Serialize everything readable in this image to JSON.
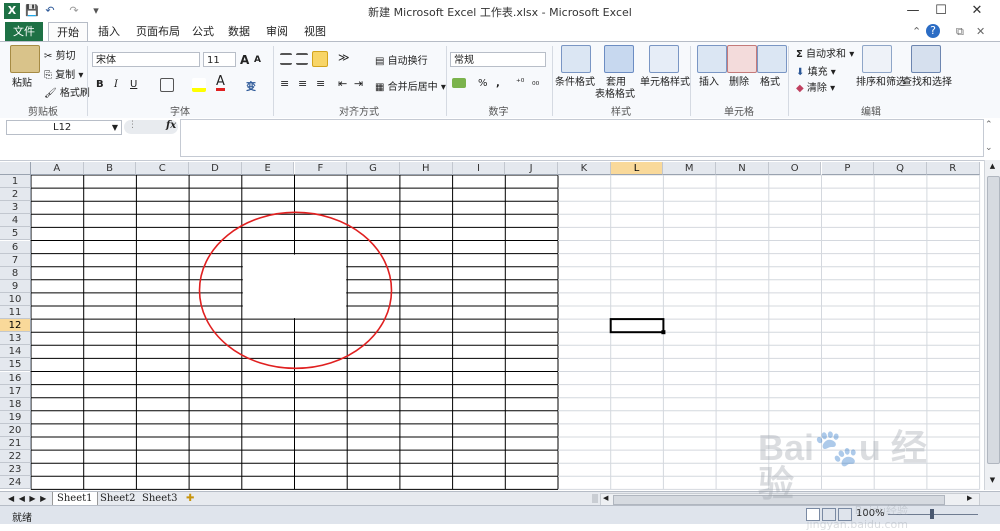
{
  "window": {
    "title": "新建 Microsoft Excel 工作表.xlsx - Microsoft Excel",
    "minimize": "—",
    "restore": "☐",
    "close": "✕"
  },
  "quick_access": {
    "save": "💾",
    "undo": "↶",
    "redo": "↷",
    "customize": "▾"
  },
  "tabs": [
    "文件",
    "开始",
    "插入",
    "页面布局",
    "公式",
    "数据",
    "审阅",
    "视图"
  ],
  "help": {
    "minimize_ribbon": "⌃",
    "help": "?",
    "restore": "⧉",
    "close": "✕"
  },
  "ribbon": {
    "clipboard": {
      "paste": "粘贴",
      "cut": "剪切",
      "copy": "复制 ▾",
      "format_painter": "格式刷",
      "label": "剪贴板"
    },
    "font": {
      "font_name": "宋体",
      "font_size": "11",
      "grow": "A",
      "shrink": "A",
      "bold": "B",
      "italic": "I",
      "underline": "U",
      "label": "字体",
      "phonetic": "变"
    },
    "alignment": {
      "wrap": "自动换行",
      "merge": "合并后居中 ▾",
      "label": "对齐方式"
    },
    "number": {
      "format": "常规",
      "percent": "%",
      "comma": ",",
      "label": "数字"
    },
    "styles": {
      "conditional": "条件格式",
      "table": "套用",
      "table2": "表格格式",
      "cell_styles": "单元格样式",
      "label": "样式"
    },
    "cells": {
      "insert": "插入",
      "delete": "删除",
      "format": "格式",
      "label": "单元格"
    },
    "editing": {
      "autosum": "自动求和 ▾",
      "fill": "填充 ▾",
      "clear": "清除 ▾",
      "sort": "排序和筛选",
      "find": "查找和选择",
      "label": "编辑"
    }
  },
  "formula_bar": {
    "name_box": "L12",
    "fx": "fx",
    "formula": ""
  },
  "grid": {
    "columns": [
      "A",
      "B",
      "C",
      "D",
      "E",
      "F",
      "G",
      "H",
      "I",
      "J",
      "K",
      "L",
      "M",
      "N",
      "O",
      "P",
      "Q",
      "R"
    ],
    "rows": [
      "1",
      "2",
      "3",
      "4",
      "5",
      "6",
      "7",
      "8",
      "9",
      "10",
      "11",
      "12",
      "13",
      "14",
      "15",
      "16",
      "17",
      "18",
      "19",
      "20",
      "21",
      "22",
      "23",
      "24"
    ],
    "selected_cell": "L12",
    "annotation_color": "#e02020"
  },
  "sheets": {
    "tabs": [
      "Sheet1",
      "Sheet2",
      "Sheet3"
    ],
    "nav": "◀ ◀ ▶ ▶"
  },
  "status": {
    "ready": "就绪",
    "zoom": "100%"
  },
  "watermark": "Baidu经验 jingyan.baidu.com"
}
